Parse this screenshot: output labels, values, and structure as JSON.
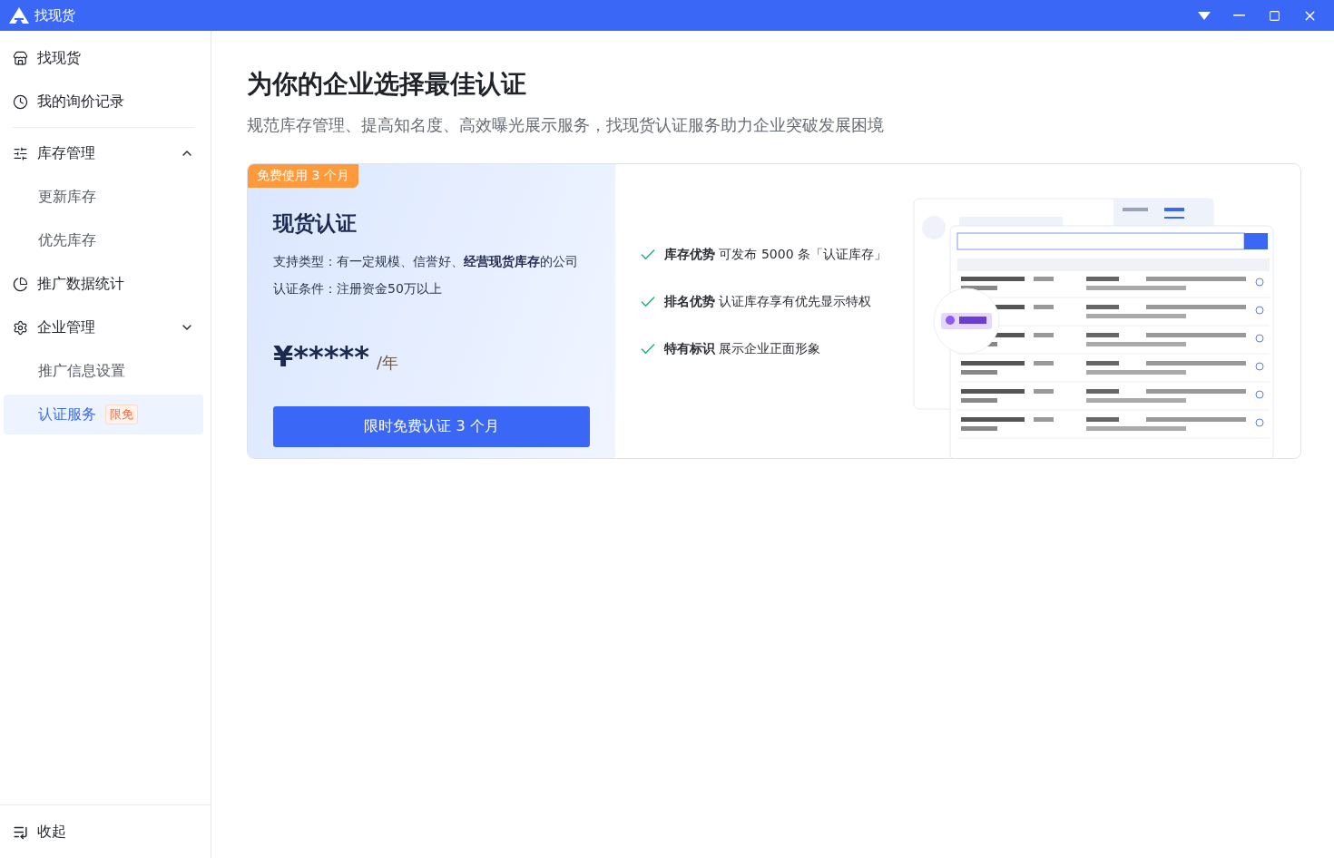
{
  "window": {
    "title": "找现货"
  },
  "sidebar": {
    "items": [
      {
        "label": "找现货",
        "selected": false
      },
      {
        "label": "我的询价记录",
        "selected": false
      },
      {
        "label": "库存管理",
        "selected": false,
        "expanded": true,
        "children": [
          {
            "label": "更新库存",
            "selected": false
          },
          {
            "label": "优先库存",
            "selected": false
          }
        ]
      },
      {
        "label": "推广数据统计",
        "selected": false
      },
      {
        "label": "企业管理",
        "selected": false,
        "expanded": false,
        "children": [
          {
            "label": "推广信息设置",
            "selected": false
          },
          {
            "label": "认证服务",
            "selected": true,
            "badge": "限免"
          }
        ]
      }
    ],
    "collapse": "收起"
  },
  "main": {
    "title": "为你的企业选择最佳认证",
    "subtitle": "规范库存管理、提高知名度、高效曝光展示服务，找现货认证服务助力企业突破发展困境",
    "plan": {
      "badge": "免费使用 3 个月",
      "name": "现货认证",
      "lines": [
        "支持类型：有一定规模、信誉好、**经营现货库存**的公司",
        "认证条件：注册资金50万以上"
      ],
      "price": "¥*****",
      "unit": "/年",
      "button": "限时免费认证 3 个月"
    },
    "features": [
      {
        "title": "库存优势",
        "text": "可发布 5000 条「认证库存」"
      },
      {
        "title": "排名优势",
        "text": "认证库存享有优先显示特权"
      },
      {
        "title": "特有标识",
        "text": "展示企业正面形象"
      }
    ]
  }
}
